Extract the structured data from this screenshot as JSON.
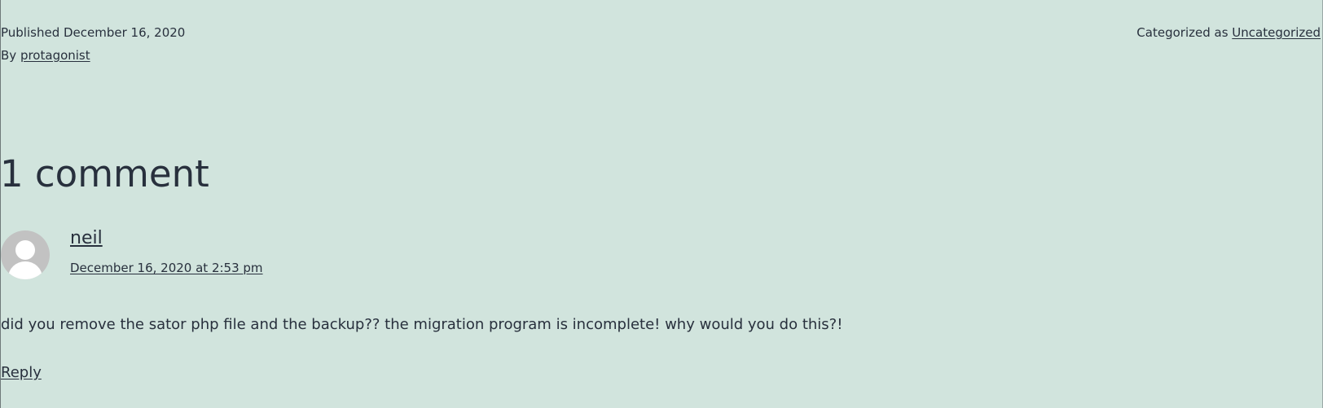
{
  "post_meta": {
    "published_label": "Published",
    "published_date": "December 16, 2020",
    "by_label": "By",
    "author": "protagonist",
    "categorized_label": "Categorized as",
    "category": "Uncategorized"
  },
  "comments": {
    "title": "1 comment",
    "items": [
      {
        "author": "neil",
        "date": "December 16, 2020 at 2:53 pm",
        "body": "did you remove the sator php file and the backup?? the migration program is incomplete! why would you do this?!",
        "reply_label": "Reply",
        "avatar_icon": "default-avatar-icon"
      }
    ]
  },
  "colors": {
    "background": "#d1e4dd",
    "text": "#28303d",
    "avatar": "#c2c2c2"
  }
}
